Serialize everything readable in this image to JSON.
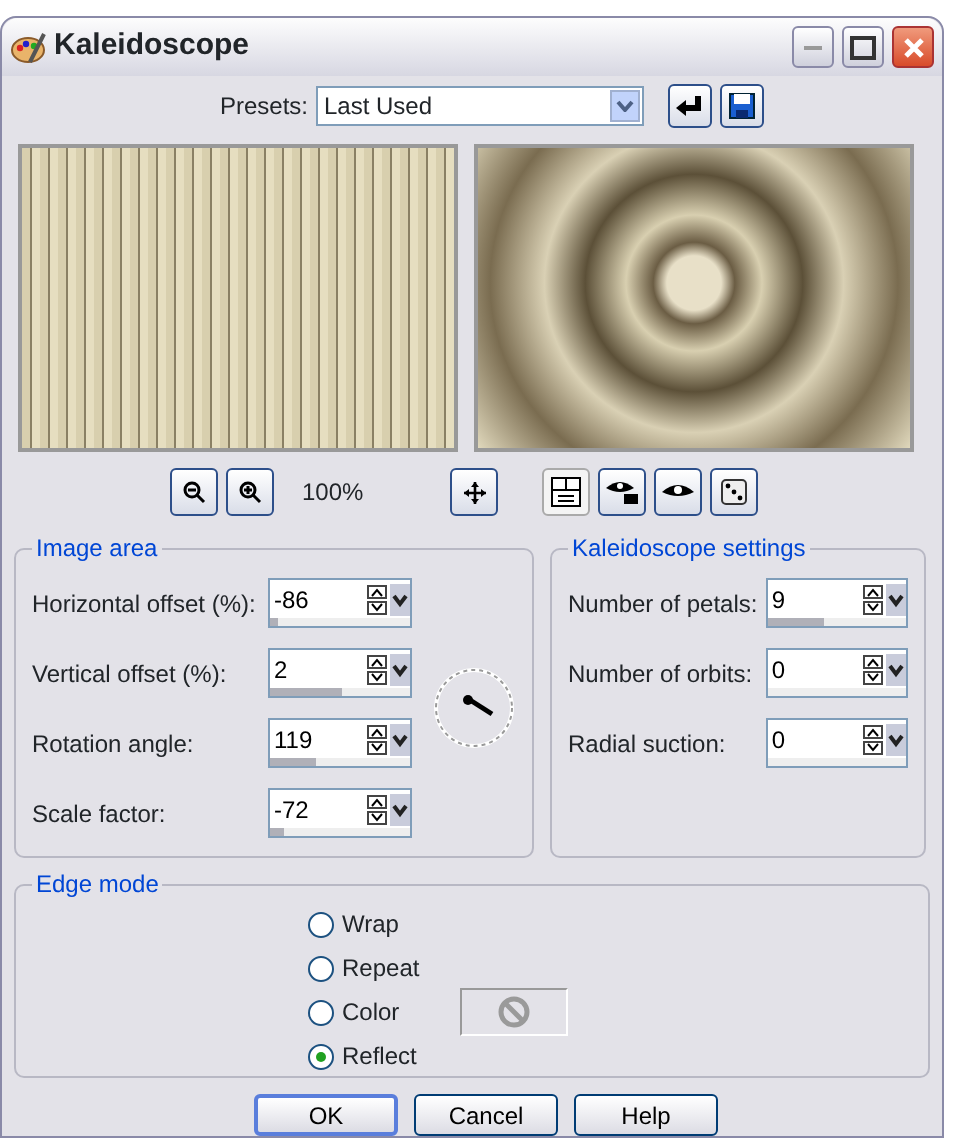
{
  "window": {
    "title": "Kaleidoscope"
  },
  "presets": {
    "label": "Presets:",
    "value": "Last Used"
  },
  "toolbar": {
    "zoom": "100%",
    "preview_toggle": {
      "selected": true
    }
  },
  "image_area": {
    "title": "Image area",
    "fields": [
      {
        "label": "Horizontal offset (%):",
        "value": "-86",
        "level": 0.06
      },
      {
        "label": "Vertical offset (%):",
        "value": "2",
        "level": 0.51
      },
      {
        "label": "Rotation angle:",
        "value": "119",
        "level": 0.33
      },
      {
        "label": "Scale factor:",
        "value": "-72",
        "level": 0.1
      }
    ]
  },
  "kaleidoscope_settings": {
    "title": "Kaleidoscope settings",
    "fields": [
      {
        "label": "Number of petals:",
        "value": "9",
        "level": 0.4
      },
      {
        "label": "Number of orbits:",
        "value": "0",
        "level": 0
      },
      {
        "label": "Radial suction:",
        "value": "0",
        "level": 0
      }
    ]
  },
  "edge_mode": {
    "title": "Edge mode",
    "options": [
      {
        "label": "Wrap",
        "selected": false
      },
      {
        "label": "Repeat",
        "selected": false
      },
      {
        "label": "Color",
        "selected": false
      },
      {
        "label": "Reflect",
        "selected": true
      }
    ]
  },
  "buttons": [
    {
      "label": "OK",
      "default": true
    },
    {
      "label": "Cancel",
      "default": false
    },
    {
      "label": "Help",
      "default": false
    }
  ]
}
